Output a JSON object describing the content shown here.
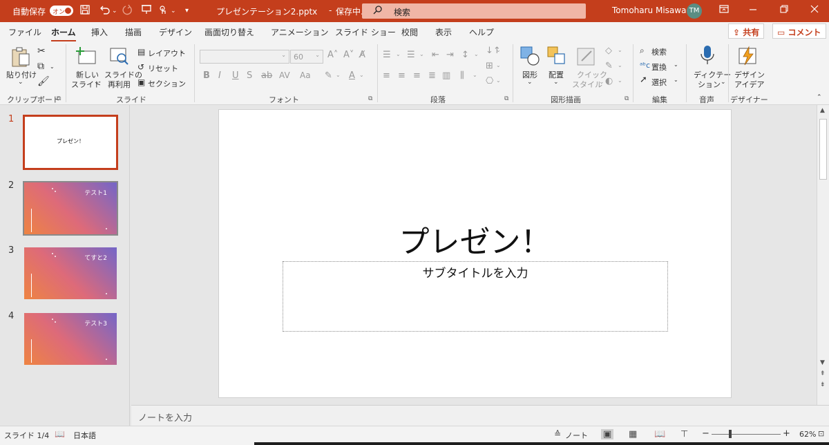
{
  "titlebar": {
    "autosave_label": "自動保存",
    "autosave_toggle": "オン",
    "doc_title": "プレゼンテーション2.pptx",
    "save_status": "保存中...",
    "search_placeholder": "検索",
    "user_name": "Tomoharu Misawa",
    "user_initials": "TM",
    "bg_color": "#c43e1c"
  },
  "tabs": [
    {
      "label": "ファイル"
    },
    {
      "label": "ホーム"
    },
    {
      "label": "挿入"
    },
    {
      "label": "描画"
    },
    {
      "label": "デザイン"
    },
    {
      "label": "画面切り替え"
    },
    {
      "label": "アニメーション"
    },
    {
      "label": "スライド ショー"
    },
    {
      "label": "校閲"
    },
    {
      "label": "表示"
    },
    {
      "label": "ヘルプ"
    }
  ],
  "share_label": "共有",
  "comment_label": "コメント",
  "ribbon": {
    "clipboard": {
      "paste": "貼り付け",
      "group": "クリップボード"
    },
    "slides": {
      "new_slide_1": "新しい",
      "new_slide_2": "スライド",
      "reuse_1": "スライドの",
      "reuse_2": "再利用",
      "layout": "レイアウト",
      "reset": "リセット",
      "section": "セクション",
      "group": "スライド"
    },
    "font": {
      "size": "60",
      "group": "フォント"
    },
    "paragraph": {
      "group": "段落"
    },
    "drawing": {
      "shapes": "図形",
      "arrange": "配置",
      "quick_styles_1": "クイック",
      "quick_styles_2": "スタイル",
      "group": "図形描画"
    },
    "editing": {
      "find": "検索",
      "replace": "置換",
      "select": "選択",
      "group": "編集"
    },
    "voice": {
      "dictate_1": "ディクテー",
      "dictate_2": "ション",
      "group": "音声"
    },
    "designer": {
      "ideas_1": "デザイン",
      "ideas_2": "アイデア",
      "group": "デザイナー"
    }
  },
  "thumbnails": [
    {
      "num": "1",
      "title": "プレゼン！"
    },
    {
      "num": "2",
      "title": "テスト1"
    },
    {
      "num": "3",
      "title": "てすと2"
    },
    {
      "num": "4",
      "title": "テスト3"
    }
  ],
  "slide": {
    "title": "プレゼン！",
    "subtitle_placeholder": "サブタイトルを入力"
  },
  "notes_placeholder": "ノートを入力",
  "status": {
    "slide_count": "スライド 1/4",
    "language": "日本語",
    "notes": "ノート",
    "zoom": "62%"
  }
}
